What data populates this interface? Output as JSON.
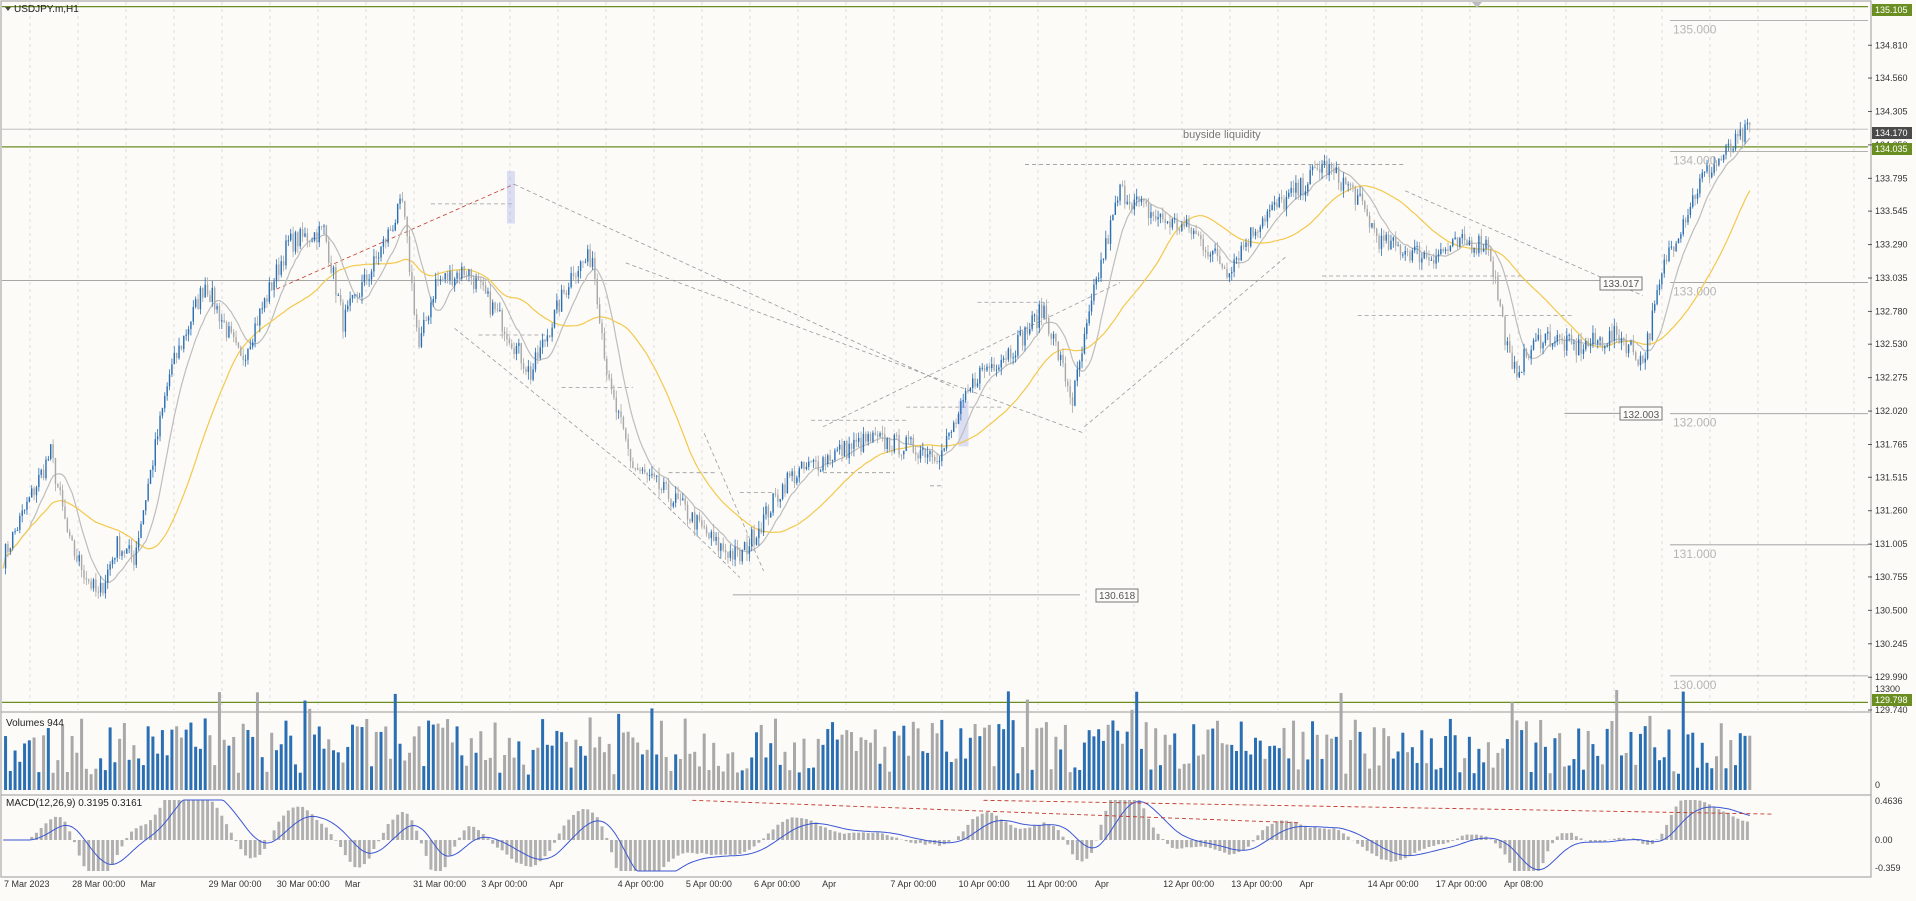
{
  "header": {
    "symbol_label": "USDJPY.m,H1"
  },
  "colors": {
    "background": "#fdfbf8",
    "bull_candle": "#2a6fb4",
    "bear_candle": "#a8a8a8",
    "ma_fast": "#bdbdbd",
    "ma_slow": "#f2c94c",
    "level_line": "#6b8e23",
    "divergence": "#c0392b",
    "macd_signal": "#3a56d4"
  },
  "price_axis": {
    "ticks": [
      "134.810",
      "134.560",
      "134.305",
      "134.050",
      "133.795",
      "133.545",
      "133.290",
      "133.035",
      "132.780",
      "132.530",
      "132.275",
      "132.020",
      "131.765",
      "131.515",
      "131.260",
      "131.005",
      "130.755",
      "130.500",
      "130.245",
      "129.990",
      "129.740"
    ],
    "top_label": "135.105",
    "price_tags": [
      "134.170",
      "134.035",
      "129.798"
    ]
  },
  "round_levels": [
    "135.000",
    "134.000",
    "133.000",
    "132.000",
    "131.000",
    "130.000"
  ],
  "level_callouts": [
    "133.017",
    "132.003",
    "130.618"
  ],
  "annotation": "buyside liquidity",
  "volumes": {
    "label": "Volumes 944",
    "axis": [
      "13300",
      "0"
    ]
  },
  "macd": {
    "label": "MACD(12,26,9) 0.3195 0.3161",
    "axis": [
      "0.4636",
      "0.00",
      "-0.359"
    ]
  },
  "time_axis": [
    "7 Mar 2023",
    "28 Mar 00:00",
    "Mar",
    "29 Mar 00:00",
    "30 Mar 00:00",
    "Mar",
    "31 Mar 00:00",
    "3 Apr 00:00",
    "Apr",
    "4 Apr 00:00",
    "5 Apr 00:00",
    "6 Apr 00:00",
    "Apr",
    "7 Apr 00:00",
    "10 Apr 00:00",
    "11 Apr 00:00",
    "Apr",
    "12 Apr 00:00",
    "13 Apr 00:00",
    "Apr",
    "14 Apr 00:00",
    "17 Apr 00:00",
    "Apr 08:00"
  ],
  "chart_data": {
    "type": "candlestick",
    "symbol": "USDJPY.m",
    "timeframe": "H1",
    "ylim": [
      129.74,
      135.14
    ],
    "anchors": [
      [
        0,
        130.9
      ],
      [
        20,
        131.7
      ],
      [
        28,
        131.0
      ],
      [
        40,
        130.6
      ],
      [
        48,
        131.0
      ],
      [
        55,
        130.9
      ],
      [
        70,
        132.3
      ],
      [
        85,
        133.0
      ],
      [
        100,
        132.4
      ],
      [
        120,
        133.3
      ],
      [
        135,
        133.4
      ],
      [
        143,
        132.7
      ],
      [
        155,
        133.1
      ],
      [
        168,
        133.6
      ],
      [
        175,
        132.5
      ],
      [
        182,
        133.0
      ],
      [
        195,
        133.1
      ],
      [
        210,
        132.7
      ],
      [
        222,
        132.3
      ],
      [
        240,
        133.1
      ],
      [
        248,
        133.2
      ],
      [
        255,
        132.2
      ],
      [
        265,
        131.6
      ],
      [
        285,
        131.3
      ],
      [
        300,
        131.0
      ],
      [
        310,
        130.9
      ],
      [
        330,
        131.5
      ],
      [
        350,
        131.7
      ],
      [
        365,
        131.8
      ],
      [
        395,
        131.7
      ],
      [
        410,
        132.3
      ],
      [
        425,
        132.5
      ],
      [
        438,
        132.8
      ],
      [
        450,
        132.1
      ],
      [
        460,
        133.0
      ],
      [
        470,
        133.7
      ],
      [
        485,
        133.5
      ],
      [
        500,
        133.4
      ],
      [
        515,
        133.1
      ],
      [
        530,
        133.5
      ],
      [
        545,
        133.7
      ],
      [
        555,
        133.9
      ],
      [
        568,
        133.7
      ],
      [
        580,
        133.3
      ],
      [
        600,
        133.2
      ],
      [
        615,
        133.3
      ],
      [
        625,
        133.3
      ],
      [
        635,
        132.3
      ],
      [
        648,
        132.6
      ],
      [
        662,
        132.5
      ],
      [
        680,
        132.6
      ],
      [
        690,
        132.4
      ],
      [
        700,
        133.2
      ],
      [
        715,
        133.8
      ],
      [
        735,
        134.17
      ]
    ],
    "candle_count": 760,
    "volumes_max": 13300,
    "macd_range": [
      -0.359,
      0.4636
    ]
  }
}
